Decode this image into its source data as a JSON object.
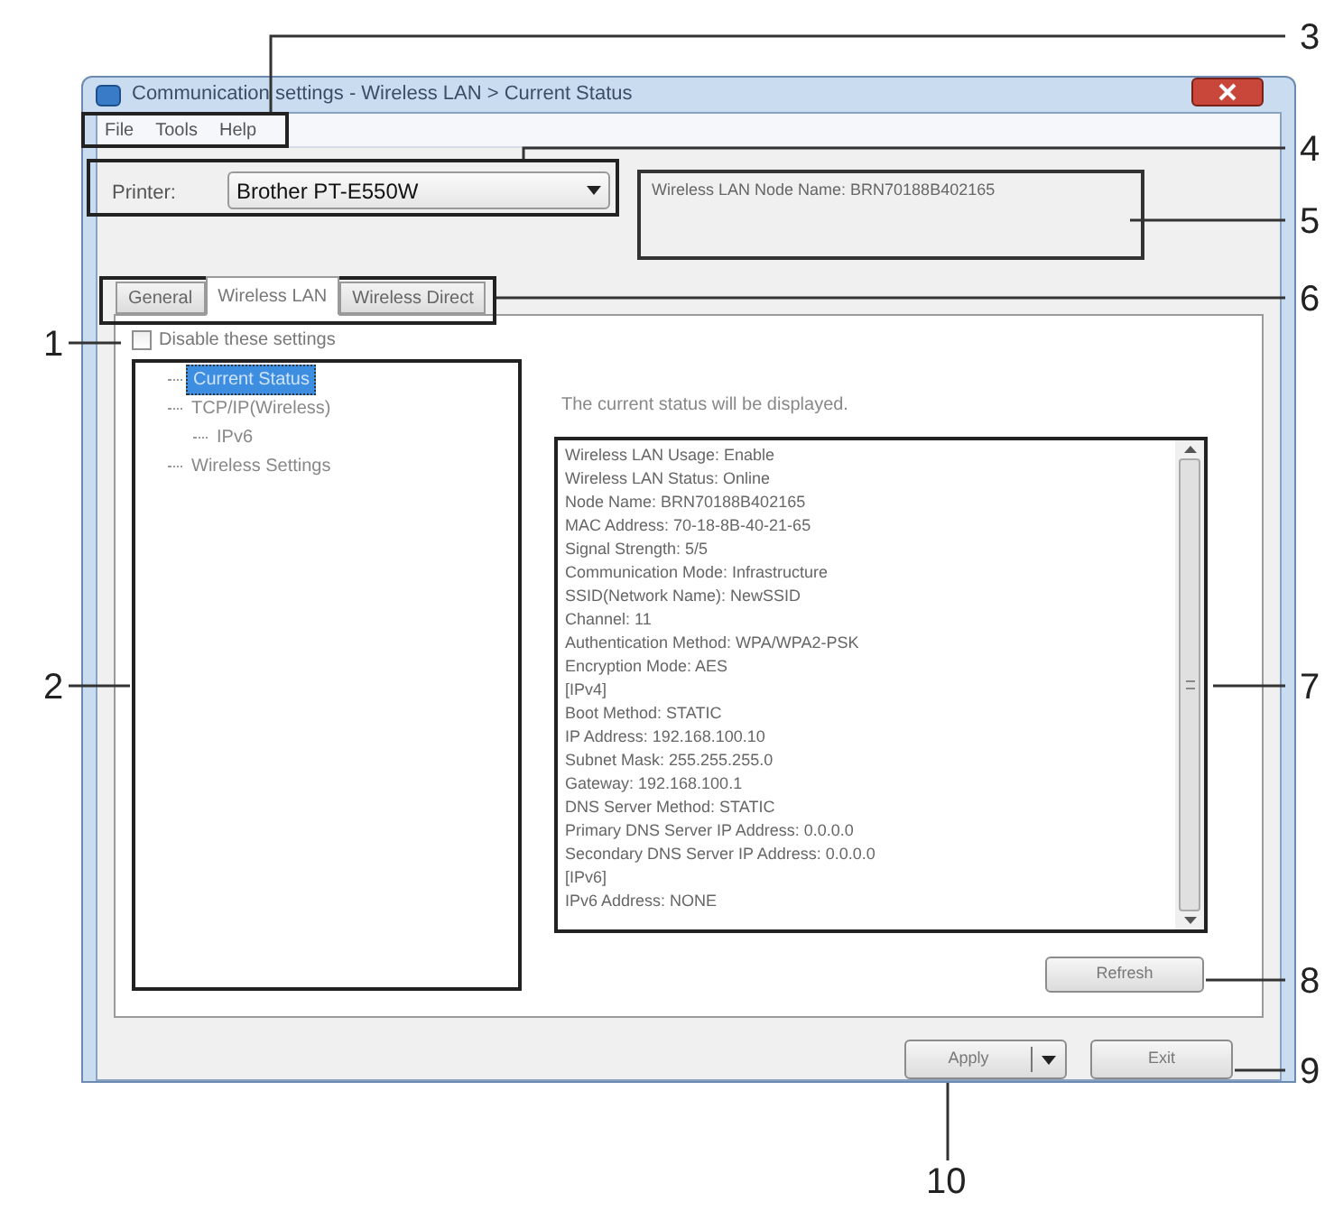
{
  "window": {
    "title": "Communication settings - Wireless LAN > Current Status"
  },
  "menu": [
    "File",
    "Tools",
    "Help"
  ],
  "printer": {
    "label": "Printer:",
    "value": "Brother PT-E550W"
  },
  "node_name": "Wireless LAN Node Name: BRN70188B402165",
  "tabs": [
    {
      "label": "General",
      "selected": false
    },
    {
      "label": "Wireless LAN",
      "selected": true
    },
    {
      "label": "Wireless Direct",
      "selected": false
    }
  ],
  "disable_settings": {
    "label": "Disable these settings",
    "checked": false
  },
  "tree": [
    {
      "label": "Current Status",
      "selected": true
    },
    {
      "label": "TCP/IP(Wireless)",
      "selected": false,
      "children": [
        {
          "label": "IPv6",
          "selected": false
        }
      ]
    },
    {
      "label": "Wireless Settings",
      "selected": false
    }
  ],
  "status_message": "The current status will be displayed.",
  "status_lines": [
    "Wireless LAN Usage: Enable",
    "Wireless LAN Status: Online",
    "Node Name: BRN70188B402165",
    "MAC Address: 70-18-8B-40-21-65",
    "Signal Strength: 5/5",
    "Communication Mode: Infrastructure",
    "SSID(Network Name): NewSSID",
    "Channel: 11",
    "Authentication Method: WPA/WPA2-PSK",
    "Encryption Mode: AES",
    "[IPv4]",
    "Boot Method: STATIC",
    "IP Address: 192.168.100.10",
    "Subnet Mask: 255.255.255.0",
    "Gateway: 192.168.100.1",
    "DNS Server Method: STATIC",
    "Primary DNS Server IP Address: 0.0.0.0",
    "Secondary DNS Server IP Address: 0.0.0.0",
    "[IPv6]",
    "IPv6 Address: NONE"
  ],
  "refresh_button": "Refresh",
  "apply_button": "Apply",
  "exit_button": "Exit",
  "callouts": [
    "1",
    "2",
    "3",
    "4",
    "5",
    "6",
    "7",
    "8",
    "9",
    "10"
  ]
}
